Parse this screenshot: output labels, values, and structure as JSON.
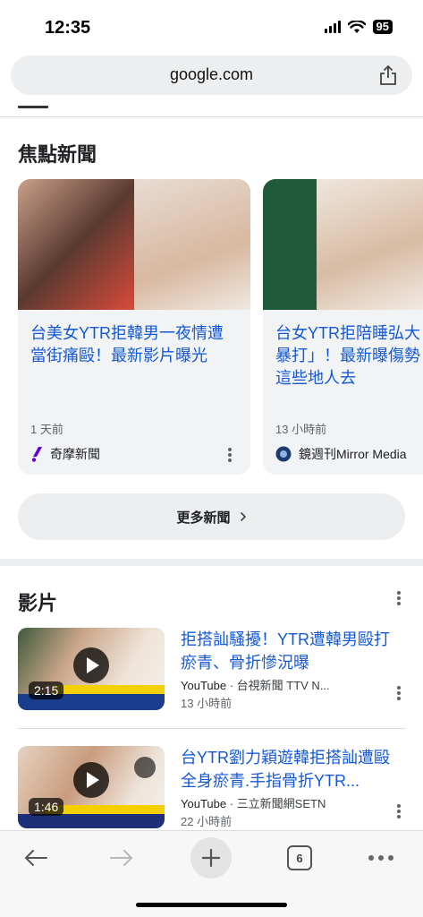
{
  "status": {
    "time": "12:35",
    "battery": "95"
  },
  "address": {
    "url": "google.com"
  },
  "news": {
    "title": "焦點新聞",
    "cards": [
      {
        "headline": "台美女YTR拒韓男一夜情遭當街痛毆！最新影片曝光",
        "time": "1 天前",
        "source": "奇摩新聞"
      },
      {
        "headline": "台女YTR拒陪睡弘大「慘遭暴打」！最新曝傷勢　示警這些地人去",
        "time": "13 小時前",
        "source": "鏡週刊Mirror Media"
      }
    ],
    "more_label": "更多新聞"
  },
  "videos": {
    "title": "影片",
    "items": [
      {
        "headline": "拒搭訕騷擾！YTR遭韓男毆打瘀青、骨折慘況曝",
        "platform": "YouTube",
        "channel": "台視新聞 TTV N...",
        "time": "13 小時前",
        "duration": "2:15"
      },
      {
        "headline": "台YTR劉力穎遊韓拒搭訕遭毆全身瘀青.手指骨折YTR...",
        "platform": "YouTube",
        "channel": "三立新聞網SETN",
        "time": "22 小時前",
        "duration": "1:46"
      }
    ]
  },
  "toolbar": {
    "tab_count": "6"
  }
}
